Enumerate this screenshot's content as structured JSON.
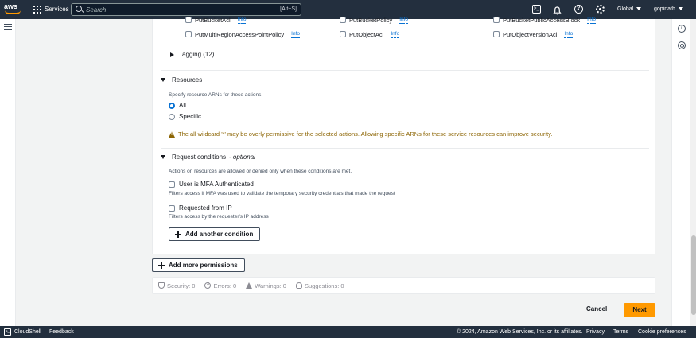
{
  "topnav": {
    "services_label": "Services",
    "search_placeholder": "Search",
    "search_shortcut": "[Alt+S]",
    "cloudshell_glyph": ">_",
    "help_glyph": "?",
    "region_label": "Global",
    "account_label": "gopinath"
  },
  "permissions": {
    "rows": [
      [
        "PutBucketAcl",
        "PutBucketPolicy",
        "PutBucketPublicAccessBlock"
      ],
      [
        "PutMultiRegionAccessPointPolicy",
        "PutObjectAcl",
        "PutObjectVersionAcl"
      ]
    ],
    "info_label": "Info",
    "tagging_label": "Tagging (12)"
  },
  "resources": {
    "heading": "Resources",
    "description": "Specify resource ARNs for these actions.",
    "options": [
      "All",
      "Specific"
    ],
    "selected": "All",
    "warning": "The all wildcard '*' may be overly permissive for the selected actions. Allowing specific ARNs for these service resources can improve security."
  },
  "request_conditions": {
    "heading": "Request conditions",
    "optional": "- optional",
    "description": "Actions on resources are allowed or denied only when these conditions are met.",
    "conditions": [
      {
        "label": "User is MFA Authenticated",
        "description": "Filters access if MFA was used to validate the temporary security credentials that made the request"
      },
      {
        "label": "Requested from IP",
        "description": "Filters access by the requester's IP address"
      }
    ],
    "add_condition_label": "Add another condition"
  },
  "add_permissions_label": "Add more permissions",
  "validation": {
    "security": "Security: 0",
    "errors": "Errors: 0",
    "warnings": "Warnings: 0",
    "suggestions": "Suggestions: 0"
  },
  "actions": {
    "cancel_label": "Cancel",
    "next_label": "Next"
  },
  "footer": {
    "cloudshell_label": "CloudShell",
    "feedback_label": "Feedback",
    "copyright": "© 2024, Amazon Web Services, Inc. or its affiliates.",
    "privacy_label": "Privacy",
    "terms_label": "Terms",
    "cookie_label": "Cookie preferences"
  },
  "colors": {
    "nav_bg": "#232f3e",
    "accent_orange": "#ff9900",
    "link_blue": "#0972d3",
    "warning_text": "#8d6605"
  }
}
